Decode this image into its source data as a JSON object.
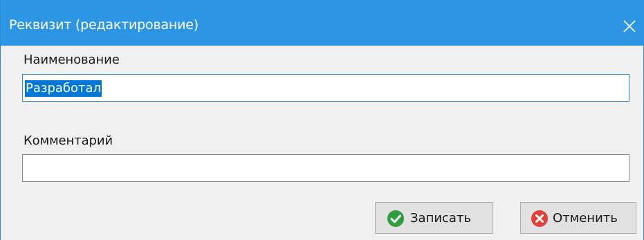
{
  "window": {
    "title": "Реквизит (редактирование)",
    "accent_color": "#2c96e5",
    "close_icon": "close-icon"
  },
  "form": {
    "name_label": "Наименование",
    "name_value": "Разработал",
    "comment_label": "Комментарий",
    "comment_value": ""
  },
  "buttons": {
    "save_label": "Записать",
    "save_icon": "check-circle-icon",
    "save_icon_color": "#2e9e3e",
    "cancel_label": "Отменить",
    "cancel_icon": "x-circle-icon",
    "cancel_icon_color": "#e0413a"
  }
}
